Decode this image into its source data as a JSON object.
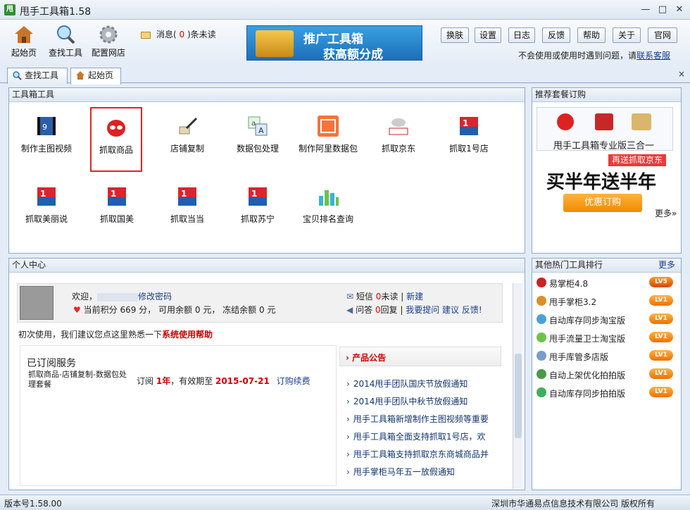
{
  "window": {
    "title": "甩手工具箱1.58",
    "app_icon_text": "甩",
    "minimize": "—",
    "maximize": "□",
    "close": "✕"
  },
  "toolbar": {
    "home": "起始页",
    "find": "查找工具",
    "config": "配置网店",
    "msg_prefix": "消息(",
    "msg_count": "0",
    "msg_suffix": ")条未读",
    "banner_line1": "推广工具箱",
    "banner_line2": "获高额分成",
    "buttons": [
      "换肤",
      "设置",
      "日志",
      "反馈",
      "帮助",
      "关于",
      "官网"
    ],
    "help_text": "不会使用或使用时遇到问题，请",
    "help_link": "联系客服"
  },
  "tabs": [
    "查找工具",
    "起始页"
  ],
  "tab_close": "×",
  "toolbox": {
    "title": "工具箱工具",
    "tools": [
      "制作主图视频",
      "抓取商品",
      "店铺复制",
      "数据包处理",
      "制作阿里数据包",
      "抓取京东",
      "抓取1号店",
      "抓取美丽说",
      "抓取国美",
      "抓取当当",
      "抓取苏宁",
      "宝贝排名查询"
    ]
  },
  "recommend": {
    "title": "推荐套餐订购",
    "pack_title": "甩手工具箱专业版三合一",
    "badge": "再送抓取京东",
    "big": "买半年送半年",
    "button": "优惠订购",
    "more": "更多»"
  },
  "hot": {
    "title": "其他热门工具排行",
    "more": "更多",
    "items": [
      {
        "name": "易掌柜4.8",
        "level": "LV5"
      },
      {
        "name": "甩手掌柜3.2",
        "level": "LV1"
      },
      {
        "name": "自动库存同步淘宝版",
        "level": "LV1"
      },
      {
        "name": "甩手流量卫士淘宝版",
        "level": "LV1"
      },
      {
        "name": "甩手库管多店版",
        "level": "LV1"
      },
      {
        "name": "自动上架优化拍拍版",
        "level": "LV1"
      },
      {
        "name": "自动库存同步拍拍版",
        "level": "LV1"
      }
    ]
  },
  "personal": {
    "title": "个人中心",
    "welcome": "欢迎，",
    "change_pwd": "修改密码",
    "points_label": "当前积分",
    "points": "669",
    "points_unit": "分，",
    "balance_label": "可用余额",
    "balance": "0",
    "balance_unit": "元，",
    "frozen_label": "冻结余额",
    "frozen": "0",
    "frozen_unit": "元",
    "sms_label": "短信",
    "sms_count": "0",
    "sms_unread": "未读",
    "sms_new": "新建",
    "qa_label": "问答",
    "qa_count": "0",
    "qa_reply": "回复",
    "qa_actions": "我要提问 建议 反馈!",
    "first_use": "初次使用，我们建议您点这里熟悉一下",
    "help_link": "系统使用帮助"
  },
  "subscribed": {
    "title": "已订阅服务",
    "service": "抓取商品-店铺复制-数据包处理套餐",
    "sub_label": "订阅",
    "duration": "1年",
    "valid_label": "，有效期至",
    "expiry": "2015-07-21",
    "renew": "订购续费"
  },
  "notices": {
    "title": "产品公告",
    "items": [
      "2014甩手团队国庆节放假通知",
      "2014甩手团队中秋节放假通知",
      "甩手工具箱新增制作主图视频等重要",
      "甩手工具箱全面支持抓取1号店，欢",
      "甩手工具箱支持抓取京东商城商品并",
      "甩手掌柜马年五一放假通知"
    ]
  },
  "status": {
    "version": "版本号1.58.00",
    "company": "深圳市华通易点信息技术有限公司  版权所有"
  },
  "colors": {
    "accent": "#1a3e8c",
    "red": "#cc0000",
    "orange": "#f08a00"
  }
}
